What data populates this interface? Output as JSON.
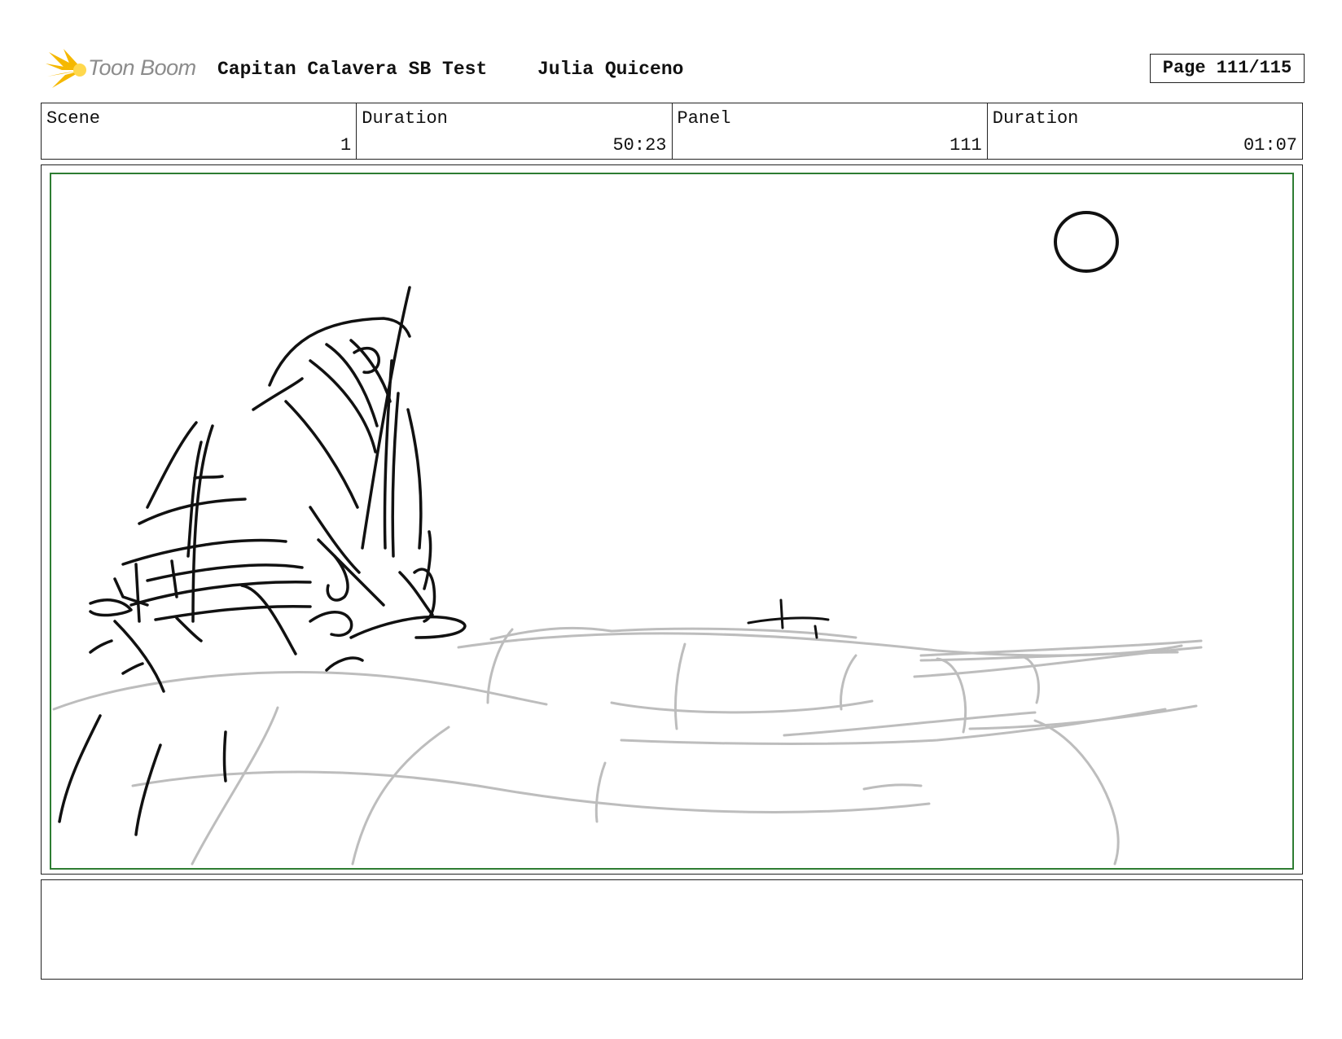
{
  "header": {
    "logo_text": "Toon Boom",
    "project_title": "Capitan Calavera SB Test",
    "author": "Julia Quiceno",
    "page_label": "Page 111/115"
  },
  "info": {
    "scene_label": "Scene",
    "scene_value": "1",
    "scene_duration_label": "Duration",
    "scene_duration_value": "50:23",
    "panel_label": "Panel",
    "panel_value": "111",
    "panel_duration_label": "Duration",
    "panel_duration_value": "01:07"
  },
  "panel": {
    "safe_area_color": "#2e7d32",
    "sketch_ink_color": "#111111",
    "sketch_wave_color": "#bdbdbd"
  },
  "notes": {
    "text": ""
  },
  "icons": {
    "logo": "toon-boom-burst-icon"
  }
}
